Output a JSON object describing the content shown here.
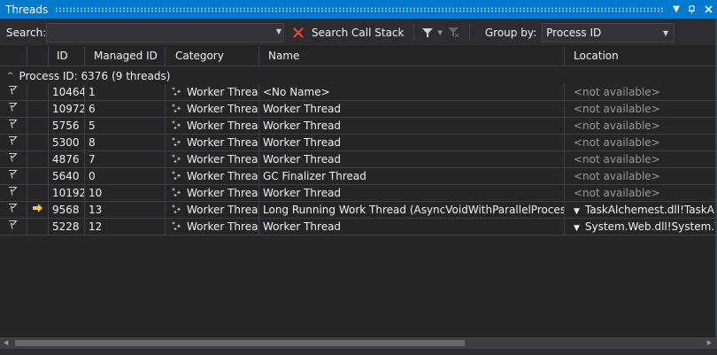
{
  "window": {
    "title": "Threads"
  },
  "toolbar": {
    "search_label": "Search:",
    "search_value": "",
    "search_call_stack_label": "Search Call Stack",
    "group_by_label": "Group by:",
    "group_by_value": "Process ID"
  },
  "columns": {
    "id": "ID",
    "managed_id": "Managed ID",
    "category": "Category",
    "name": "Name",
    "location": "Location"
  },
  "group": {
    "label": "Process ID: 6376",
    "count": "(9 threads)"
  },
  "threads": [
    {
      "id": "10464",
      "managed_id": "1",
      "category": "Worker Thread",
      "name": "<No Name>",
      "location": "<not available>",
      "current": false,
      "expandable": false
    },
    {
      "id": "10972",
      "managed_id": "6",
      "category": "Worker Thread",
      "name": "Worker Thread",
      "location": "<not available>",
      "current": false,
      "expandable": false
    },
    {
      "id": "5756",
      "managed_id": "5",
      "category": "Worker Thread",
      "name": "Worker Thread",
      "location": "<not available>",
      "current": false,
      "expandable": false
    },
    {
      "id": "5300",
      "managed_id": "8",
      "category": "Worker Thread",
      "name": "Worker Thread",
      "location": "<not available>",
      "current": false,
      "expandable": false
    },
    {
      "id": "4876",
      "managed_id": "7",
      "category": "Worker Thread",
      "name": "Worker Thread",
      "location": "<not available>",
      "current": false,
      "expandable": false
    },
    {
      "id": "5640",
      "managed_id": "0",
      "category": "Worker Thread",
      "name": "GC Finalizer Thread",
      "location": "<not available>",
      "current": false,
      "expandable": false
    },
    {
      "id": "10192",
      "managed_id": "10",
      "category": "Worker Thread",
      "name": "Worker Thread",
      "location": "<not available>",
      "current": false,
      "expandable": false
    },
    {
      "id": "9568",
      "managed_id": "13",
      "category": "Worker Thread",
      "name": "Long Running Work Thread (AsyncVoidWithParallelProcessing)",
      "location": "TaskAlchemest.dll!TaskAlchemest",
      "current": true,
      "expandable": true
    },
    {
      "id": "5228",
      "managed_id": "12",
      "category": "Worker Thread",
      "name": "Worker Thread",
      "location": "System.Web.dll!System.Web",
      "current": false,
      "expandable": true
    }
  ],
  "colors": {
    "accent": "#007acc",
    "background": "#252526",
    "current_arrow": "#f6c342",
    "clear_x": "#e8463a"
  }
}
